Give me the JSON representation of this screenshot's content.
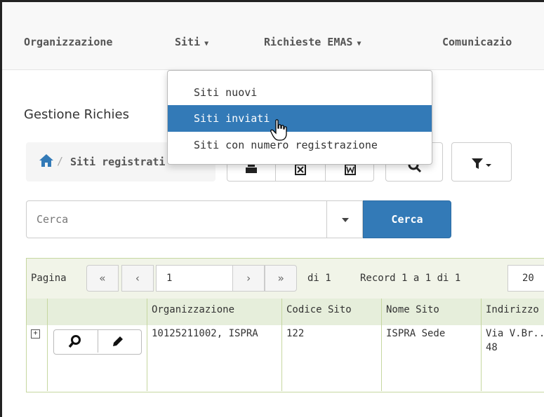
{
  "navbar": {
    "items": [
      {
        "label": "Organizzazione",
        "caret": false
      },
      {
        "label": "Siti",
        "caret": true
      },
      {
        "label": "Richieste EMAS",
        "caret": true
      },
      {
        "label": "Comunicazio",
        "caret": false
      }
    ]
  },
  "page": {
    "title": "Gestione Richies"
  },
  "breadcrumb": {
    "label": "Siti registrati",
    "separator": "/"
  },
  "search": {
    "placeholder": "Cerca",
    "button_label": "Cerca"
  },
  "pager": {
    "page_label": "Pagina",
    "current_page": "1",
    "of_label": "di 1",
    "records_label": "Record 1 a 1 di 1",
    "page_size": "20"
  },
  "table": {
    "columns": [
      "Organizzazione",
      "Codice Sito",
      "Nome Sito",
      "Indirizzo"
    ],
    "rows": [
      {
        "organizzazione": "10125211002, ISPRA",
        "codice_sito": "122",
        "nome_sito": "ISPRA Sede",
        "indirizzo": "Via V.Br... 48"
      }
    ]
  },
  "dropdown_menu": {
    "items": [
      {
        "label": "Siti nuovi",
        "active": false
      },
      {
        "label": "Siti inviati",
        "active": true
      },
      {
        "label": "Siti con numero registrazione",
        "active": false
      }
    ]
  },
  "colors": {
    "primary": "#337ab7",
    "grid_border": "#c6d7a0",
    "grid_header": "#e6eedb"
  }
}
